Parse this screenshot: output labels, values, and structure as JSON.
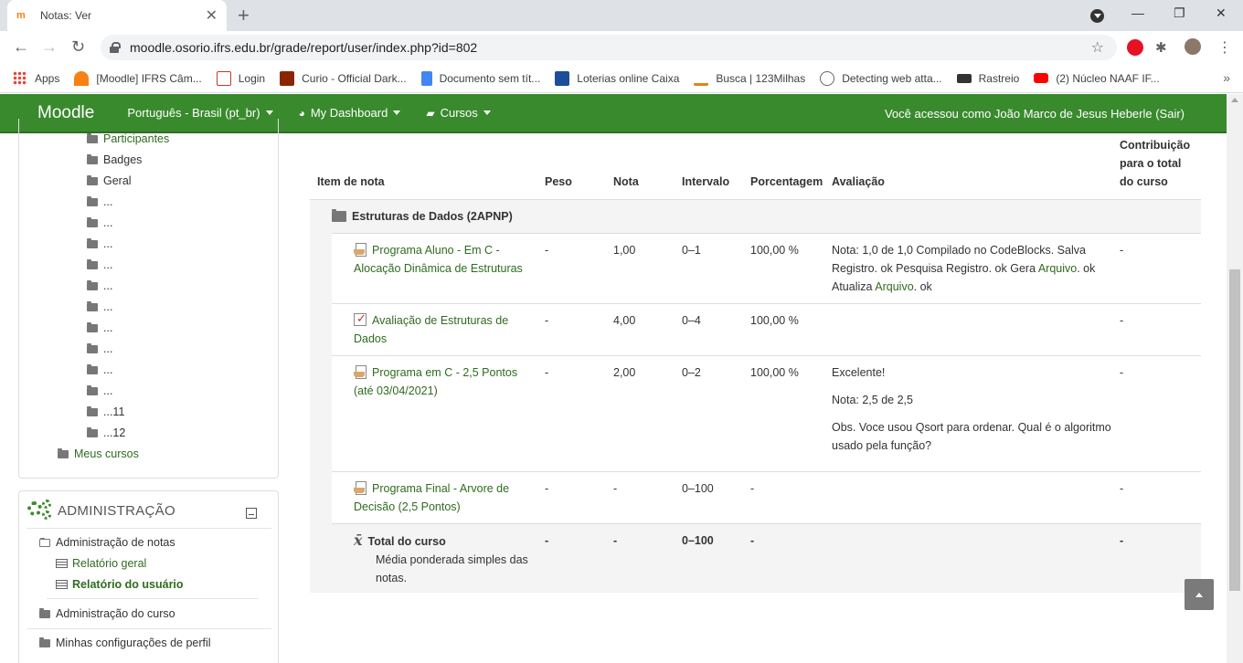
{
  "browser": {
    "tab_title": "Notas: Ver",
    "tab_favicon": "m",
    "url": "moodle.osorio.ifrs.edu.br/grade/report/user/index.php?id=802",
    "bookmarks": [
      {
        "label": "Apps",
        "color": "#ea4335"
      },
      {
        "label": "[Moodle] IFRS Câm...",
        "color": "#f98012"
      },
      {
        "label": "Login",
        "color": "#c0392b"
      },
      {
        "label": "Curio - Official Dark...",
        "color": "#8b2500"
      },
      {
        "label": "Documento sem tít...",
        "color": "#4285f4"
      },
      {
        "label": "Loterias online Caixa",
        "color": "#1c4e9b"
      },
      {
        "label": "Busca | 123Milhas",
        "color": "#e67e22"
      },
      {
        "label": "Detecting web atta...",
        "color": "#666666"
      },
      {
        "label": "Rastreio",
        "color": "#333333"
      },
      {
        "label": "(2) Núcleo NAAF IF...",
        "color": "#ff0000"
      }
    ]
  },
  "navbar": {
    "brand": "Moodle",
    "language": "Português - Brasil (pt_br)",
    "dashboard": "My Dashboard",
    "courses": "Cursos",
    "user": "Você acessou como João Marco de Jesus Heberle (Sair)"
  },
  "sidebar": {
    "tree": [
      {
        "label": "Participantes",
        "link": true
      },
      {
        "label": "Badges",
        "link": false
      },
      {
        "label": "Geral",
        "link": false
      },
      {
        "label": "...",
        "link": false
      },
      {
        "label": "...",
        "link": false
      },
      {
        "label": "...",
        "link": false
      },
      {
        "label": "...",
        "link": false
      },
      {
        "label": "...",
        "link": false
      },
      {
        "label": "...",
        "link": false
      },
      {
        "label": "...",
        "link": false
      },
      {
        "label": "...",
        "link": false
      },
      {
        "label": "...",
        "link": false
      },
      {
        "label": "...",
        "link": false
      },
      {
        "label": "...11",
        "link": false
      },
      {
        "label": "...12",
        "link": false
      }
    ],
    "my_courses": "Meus cursos",
    "admin": {
      "title": "ADMINISTRAÇÃO",
      "grades_admin": "Administração de notas",
      "overview_report": "Relatório geral",
      "user_report": "Relatório do usuário",
      "course_admin": "Administração do curso",
      "profile_settings": "Minhas configurações de perfil"
    }
  },
  "grades": {
    "headers": {
      "item": "Item de nota",
      "weight": "Peso",
      "grade": "Nota",
      "range": "Intervalo",
      "percentage": "Porcentagem",
      "feedback": "Avaliação",
      "contrib_1": "Contribuição",
      "contrib_2": "para o total",
      "contrib_3": "do curso"
    },
    "category": "Estruturas de Dados (2APNP)",
    "rows": [
      {
        "name_1": "Programa Aluno - Em C -",
        "name_2": "Alocação Dinâmica de Estruturas",
        "weight": "-",
        "grade": "1,00",
        "range": "0–1",
        "percentage": "100,00 %",
        "fb_1": "Nota: 1,0 de 1,0 Compilado no CodeBlocks.  Salva",
        "fb_2a": "Registro. ok Pesquisa Registro. ok Gera ",
        "fb_2link": "Arquivo",
        "fb_2b": ". ok",
        "fb_3a": "Atualiza ",
        "fb_3link": "Arquivo",
        "fb_3b": ". ok",
        "contrib": "-"
      },
      {
        "name_1": "Avaliação de Estruturas de",
        "name_2": "Dados",
        "weight": "-",
        "grade": "4,00",
        "range": "0–4",
        "percentage": "100,00 %",
        "contrib": "-"
      },
      {
        "name_1": "Programa em C - 2,5 Pontos",
        "name_2": "(até 03/04/2021)",
        "weight": "-",
        "grade": "2,00",
        "range": "0–2",
        "percentage": "100,00 %",
        "fb_1": "Excelente!",
        "fb_2": "Nota: 2,5 de 2,5",
        "fb_3": "Obs. Voce usou Qsort para ordenar. Qual é o algoritmo",
        "fb_4": "usado pela função?",
        "contrib": "-"
      },
      {
        "name_1": "Programa Final - Arvore de",
        "name_2": "Decisão (2,5 Pontos)",
        "weight": "-",
        "grade": "-",
        "range": "0–100",
        "percentage": "-",
        "contrib": "-"
      }
    ],
    "total": {
      "symbol": "x̄",
      "name": "Total do curso",
      "desc_1": "Média ponderada simples das",
      "desc_2": "notas.",
      "weight": "-",
      "grade": "-",
      "range": "0–100",
      "percentage": "-",
      "contrib": "-"
    }
  }
}
